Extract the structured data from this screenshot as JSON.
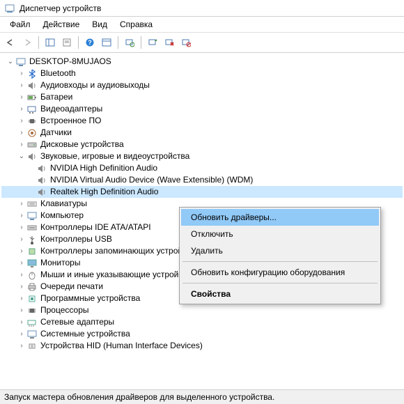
{
  "window": {
    "title": "Диспетчер устройств"
  },
  "menu": {
    "file": "Файл",
    "action": "Действие",
    "view": "Вид",
    "help": "Справка"
  },
  "root": {
    "name": "DESKTOP-8MUJAOS"
  },
  "categories": {
    "bluetooth": "Bluetooth",
    "audio_io": "Аудиовходы и аудиовыходы",
    "batteries": "Батареи",
    "video_adapters": "Видеоадаптеры",
    "firmware": "Встроенное ПО",
    "sensors": "Датчики",
    "disk": "Дисковые устройства",
    "sound": "Звуковые, игровые и видеоустройства",
    "keyboards": "Клавиатуры",
    "computer": "Компьютер",
    "ide": "Контроллеры IDE ATA/ATAPI",
    "usb": "Контроллеры USB",
    "storage": "Контроллеры запоминающих устройств",
    "monitors": "Мониторы",
    "mice": "Мыши и иные указывающие устройства",
    "print": "Очереди печати",
    "software": "Программные устройства",
    "cpu": "Процессоры",
    "net": "Сетевые адаптеры",
    "system": "Системные устройства",
    "hid": "Устройства HID (Human Interface Devices)"
  },
  "sound_children": {
    "nvhd": "NVIDIA High Definition Audio",
    "nvvad": "NVIDIA Virtual Audio Device (Wave Extensible) (WDM)",
    "realtek": "Realtek High Definition Audio"
  },
  "context": {
    "update": "Обновить драйверы...",
    "disable": "Отключить",
    "delete": "Удалить",
    "refresh": "Обновить конфигурацию оборудования",
    "properties": "Свойства"
  },
  "status": "Запуск мастера обновления драйверов для выделенного устройства."
}
